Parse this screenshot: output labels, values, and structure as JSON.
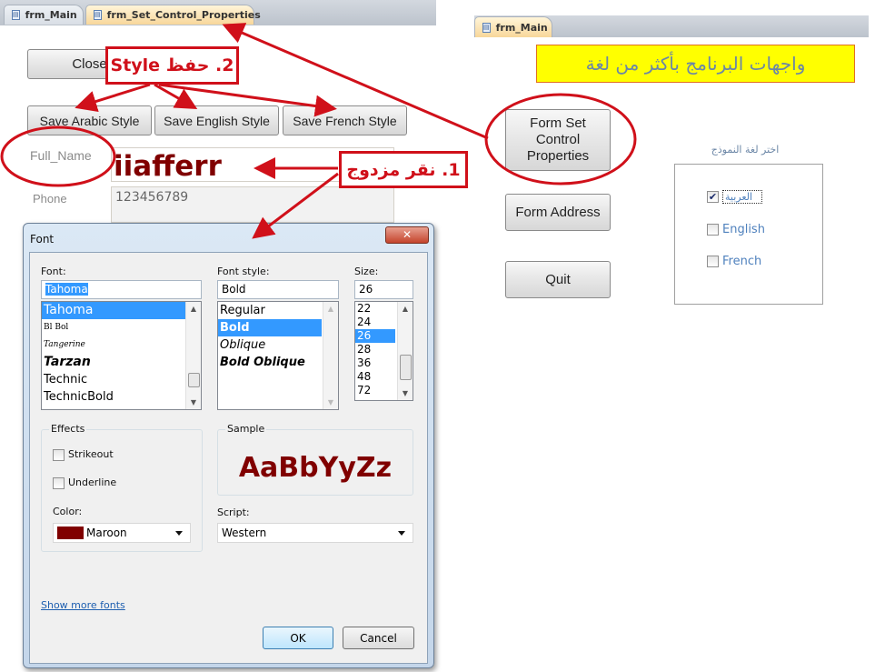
{
  "left_form": {
    "tabs": [
      {
        "label": "frm_Main",
        "active": false
      },
      {
        "label": "frm_Set_Control_Properties",
        "active": true
      }
    ],
    "close_label": "Close",
    "save_buttons": [
      "Save Arabic  Style",
      "Save English  Style",
      "Save French  Style"
    ],
    "full_name_label": "Full_Name",
    "full_name_value": "iiafferr",
    "phone_label": "Phone",
    "phone_value": "123456789"
  },
  "annotations": {
    "step2": "2. حفظ Style",
    "step1": "1. نقر مزدوج",
    "color": "#d0101a"
  },
  "font_dialog": {
    "title": "Font",
    "close_icon": "close-icon",
    "font_label": "Font:",
    "font_value": "Tahoma",
    "fonts": [
      "Tahoma",
      "Bl Bol",
      "Tangerine",
      "Tarzan",
      "Technic",
      "TechnicBold"
    ],
    "style_label": "Font style:",
    "style_value": "Bold",
    "styles": [
      "Regular",
      "Bold",
      "Oblique",
      "Bold Oblique"
    ],
    "size_label": "Size:",
    "size_value": "26",
    "sizes": [
      "22",
      "24",
      "26",
      "28",
      "36",
      "48",
      "72"
    ],
    "effects_label": "Effects",
    "strikeout_label": "Strikeout",
    "strikeout_checked": false,
    "underline_label": "Underline",
    "underline_checked": false,
    "color_label": "Color:",
    "color_value": "Maroon",
    "color_hex": "#800000",
    "sample_label": "Sample",
    "sample_text": "AaBbYyZz",
    "script_label": "Script:",
    "script_value": "Western",
    "show_more_fonts": "Show more fonts",
    "ok_label": "OK",
    "cancel_label": "Cancel"
  },
  "right_form": {
    "tab_label": "frm_Main",
    "title": "واجهات البرنامج بأكثر من لغة",
    "title_bg": "#ffff00",
    "buttons": [
      "Form Set Control Properties",
      "Form Address",
      "Quit"
    ],
    "language_label": "اختر لغة النموذج",
    "languages": [
      {
        "label": "العربية",
        "checked": true
      },
      {
        "label": "English",
        "checked": false
      },
      {
        "label": "French",
        "checked": false
      }
    ]
  }
}
